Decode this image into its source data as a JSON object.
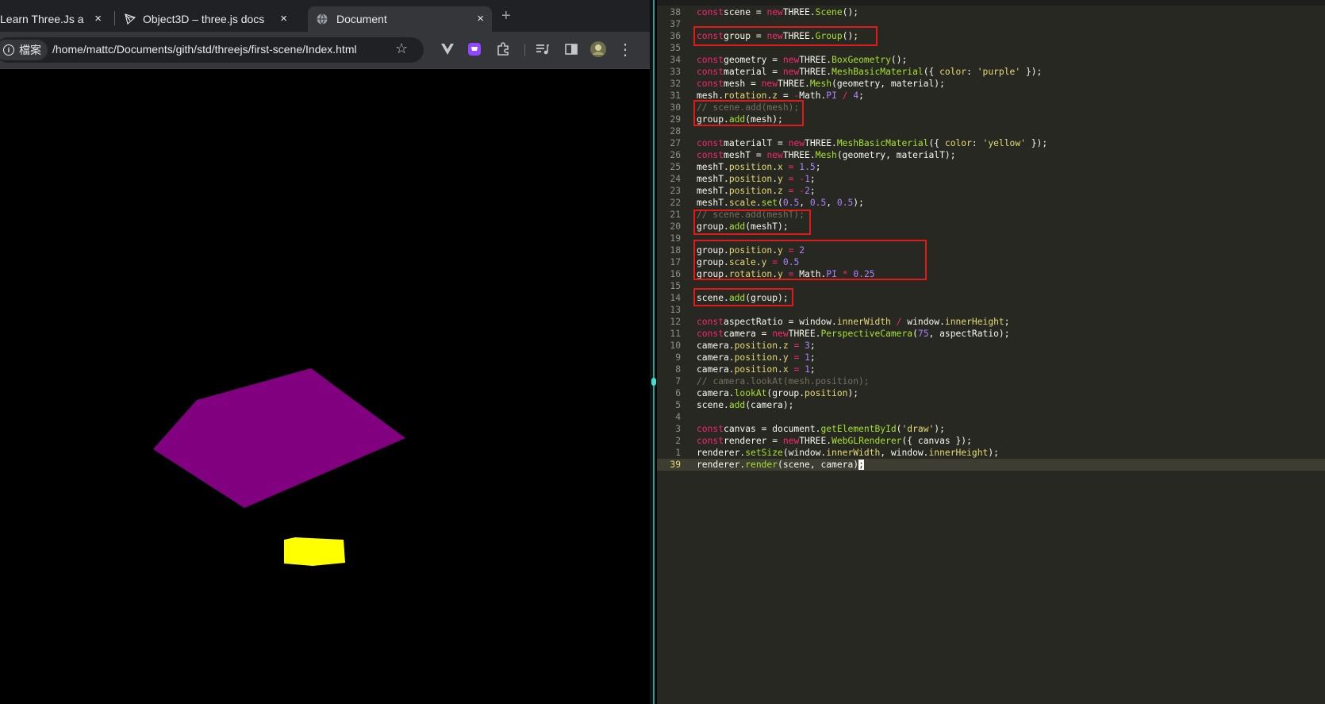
{
  "browser": {
    "tabs": [
      {
        "title": "Learn Three.Js a",
        "close": "×"
      },
      {
        "title": "Object3D – three.js docs",
        "close": "×"
      },
      {
        "title": "Document",
        "close": "×"
      }
    ],
    "new_tab": "+",
    "site_chip": "檔案",
    "url": "/home/mattc/Documents/gith/std/threejs/first-scene/Index.html",
    "scene_colors": {
      "mesh": "#800080",
      "meshT": "#ffff00",
      "background": "#000000"
    }
  },
  "editor": {
    "current_line": "39",
    "lines": [
      {
        "n": "38",
        "t": [
          [
            "k",
            "const"
          ],
          [
            "",
            "scene = "
          ],
          [
            "k",
            "new"
          ],
          [
            "",
            "THREE."
          ],
          [
            "f",
            "Scene"
          ],
          [
            "",
            "();"
          ]
        ]
      },
      {
        "n": "37",
        "t": []
      },
      {
        "n": "36",
        "t": [
          [
            "k",
            "const"
          ],
          [
            "",
            "group = "
          ],
          [
            "k",
            "new"
          ],
          [
            "",
            "THREE."
          ],
          [
            "f",
            "Group"
          ],
          [
            "",
            "();"
          ]
        ]
      },
      {
        "n": "35",
        "t": []
      },
      {
        "n": "34",
        "t": [
          [
            "k",
            "const"
          ],
          [
            "",
            "geometry = "
          ],
          [
            "k",
            "new"
          ],
          [
            "",
            "THREE."
          ],
          [
            "f",
            "BoxGeometry"
          ],
          [
            "",
            "();"
          ]
        ]
      },
      {
        "n": "33",
        "t": [
          [
            "k",
            "const"
          ],
          [
            "",
            "material = "
          ],
          [
            "k",
            "new"
          ],
          [
            "",
            "THREE."
          ],
          [
            "f",
            "MeshBasicMaterial"
          ],
          [
            "",
            "({ "
          ],
          [
            "p",
            "color"
          ],
          [
            "",
            ": "
          ],
          [
            "s",
            "'purple'"
          ],
          [
            "",
            " });"
          ]
        ]
      },
      {
        "n": "32",
        "t": [
          [
            "k",
            "const"
          ],
          [
            "",
            "mesh = "
          ],
          [
            "k",
            "new"
          ],
          [
            "",
            "THREE."
          ],
          [
            "f",
            "Mesh"
          ],
          [
            "",
            "(geometry, material);"
          ]
        ]
      },
      {
        "n": "31",
        "t": [
          [
            "",
            "mesh."
          ],
          [
            "p",
            "rotation"
          ],
          [
            "",
            "."
          ],
          [
            "p",
            "z"
          ],
          [
            "",
            " = "
          ],
          [
            "k",
            "-"
          ],
          [
            "",
            "Math."
          ],
          [
            "n",
            "PI"
          ],
          [
            "",
            " "
          ],
          [
            "k",
            "/"
          ],
          [
            "",
            " "
          ],
          [
            "n",
            "4"
          ],
          [
            "",
            ";"
          ]
        ]
      },
      {
        "n": "30",
        "t": [
          [
            "c",
            "// scene.add(mesh);"
          ]
        ]
      },
      {
        "n": "29",
        "t": [
          [
            "",
            "group."
          ],
          [
            "f",
            "add"
          ],
          [
            "",
            "(mesh);"
          ]
        ]
      },
      {
        "n": "28",
        "t": []
      },
      {
        "n": "27",
        "t": [
          [
            "k",
            "const"
          ],
          [
            "",
            "materialT = "
          ],
          [
            "k",
            "new"
          ],
          [
            "",
            "THREE."
          ],
          [
            "f",
            "MeshBasicMaterial"
          ],
          [
            "",
            "({ "
          ],
          [
            "p",
            "color"
          ],
          [
            "",
            ": "
          ],
          [
            "s",
            "'yellow'"
          ],
          [
            "",
            " });"
          ]
        ]
      },
      {
        "n": "26",
        "t": [
          [
            "k",
            "const"
          ],
          [
            "",
            "meshT = "
          ],
          [
            "k",
            "new"
          ],
          [
            "",
            "THREE."
          ],
          [
            "f",
            "Mesh"
          ],
          [
            "",
            "(geometry, materialT);"
          ]
        ]
      },
      {
        "n": "25",
        "t": [
          [
            "",
            "meshT."
          ],
          [
            "p",
            "position"
          ],
          [
            "",
            "."
          ],
          [
            "p",
            "x"
          ],
          [
            "",
            " "
          ],
          [
            "k",
            "="
          ],
          [
            "",
            " "
          ],
          [
            "n",
            "1.5"
          ],
          [
            "",
            ";"
          ]
        ]
      },
      {
        "n": "24",
        "t": [
          [
            "",
            "meshT."
          ],
          [
            "p",
            "position"
          ],
          [
            "",
            "."
          ],
          [
            "p",
            "y"
          ],
          [
            "",
            " "
          ],
          [
            "k",
            "="
          ],
          [
            "",
            " "
          ],
          [
            "k",
            "-"
          ],
          [
            "n",
            "1"
          ],
          [
            "",
            ";"
          ]
        ]
      },
      {
        "n": "23",
        "t": [
          [
            "",
            "meshT."
          ],
          [
            "p",
            "position"
          ],
          [
            "",
            "."
          ],
          [
            "p",
            "z"
          ],
          [
            "",
            " "
          ],
          [
            "k",
            "="
          ],
          [
            "",
            " "
          ],
          [
            "k",
            "-"
          ],
          [
            "n",
            "2"
          ],
          [
            "",
            ";"
          ]
        ]
      },
      {
        "n": "22",
        "t": [
          [
            "",
            "meshT."
          ],
          [
            "p",
            "scale"
          ],
          [
            "",
            "."
          ],
          [
            "f",
            "set"
          ],
          [
            "",
            "("
          ],
          [
            "n",
            "0.5"
          ],
          [
            "",
            ", "
          ],
          [
            "n",
            "0.5"
          ],
          [
            "",
            ", "
          ],
          [
            "n",
            "0.5"
          ],
          [
            "",
            ");"
          ]
        ]
      },
      {
        "n": "21",
        "t": [
          [
            "c",
            "// scene.add(meshT);"
          ]
        ]
      },
      {
        "n": "20",
        "t": [
          [
            "",
            "group."
          ],
          [
            "f",
            "add"
          ],
          [
            "",
            "(meshT);"
          ]
        ]
      },
      {
        "n": "19",
        "t": []
      },
      {
        "n": "18",
        "t": [
          [
            "",
            "group."
          ],
          [
            "p",
            "position"
          ],
          [
            "",
            "."
          ],
          [
            "p",
            "y"
          ],
          [
            "",
            " "
          ],
          [
            "k",
            "="
          ],
          [
            "",
            " "
          ],
          [
            "n",
            "2"
          ]
        ]
      },
      {
        "n": "17",
        "t": [
          [
            "",
            "group."
          ],
          [
            "p",
            "scale"
          ],
          [
            "",
            "."
          ],
          [
            "p",
            "y"
          ],
          [
            "",
            " "
          ],
          [
            "k",
            "="
          ],
          [
            "",
            " "
          ],
          [
            "n",
            "0.5"
          ]
        ]
      },
      {
        "n": "16",
        "t": [
          [
            "",
            "group."
          ],
          [
            "p",
            "rotation"
          ],
          [
            "",
            "."
          ],
          [
            "p",
            "y"
          ],
          [
            "",
            " "
          ],
          [
            "k",
            "="
          ],
          [
            "",
            " Math."
          ],
          [
            "n",
            "PI"
          ],
          [
            "",
            " "
          ],
          [
            "k",
            "*"
          ],
          [
            "",
            " "
          ],
          [
            "n",
            "0.25"
          ]
        ]
      },
      {
        "n": "15",
        "t": []
      },
      {
        "n": "14",
        "t": [
          [
            "",
            "scene."
          ],
          [
            "f",
            "add"
          ],
          [
            "",
            "(group);"
          ]
        ]
      },
      {
        "n": "13",
        "t": []
      },
      {
        "n": "12",
        "t": [
          [
            "k",
            "const"
          ],
          [
            "",
            "aspectRatio = window."
          ],
          [
            "p",
            "innerWidth"
          ],
          [
            "",
            " "
          ],
          [
            "k",
            "/"
          ],
          [
            "",
            " window."
          ],
          [
            "p",
            "innerHeight"
          ],
          [
            "",
            ";"
          ]
        ]
      },
      {
        "n": "11",
        "t": [
          [
            "k",
            "const"
          ],
          [
            "",
            "camera = "
          ],
          [
            "k",
            "new"
          ],
          [
            "",
            "THREE."
          ],
          [
            "f",
            "PerspectiveCamera"
          ],
          [
            "",
            "("
          ],
          [
            "n",
            "75"
          ],
          [
            "",
            ", aspectRatio);"
          ]
        ]
      },
      {
        "n": "10",
        "t": [
          [
            "",
            "camera."
          ],
          [
            "p",
            "position"
          ],
          [
            "",
            "."
          ],
          [
            "p",
            "z"
          ],
          [
            "",
            " "
          ],
          [
            "k",
            "="
          ],
          [
            "",
            " "
          ],
          [
            "n",
            "3"
          ],
          [
            "",
            ";"
          ]
        ]
      },
      {
        "n": "9",
        "t": [
          [
            "",
            "camera."
          ],
          [
            "p",
            "position"
          ],
          [
            "",
            "."
          ],
          [
            "p",
            "y"
          ],
          [
            "",
            " "
          ],
          [
            "k",
            "="
          ],
          [
            "",
            " "
          ],
          [
            "n",
            "1"
          ],
          [
            "",
            ";"
          ]
        ]
      },
      {
        "n": "8",
        "t": [
          [
            "",
            "camera."
          ],
          [
            "p",
            "position"
          ],
          [
            "",
            "."
          ],
          [
            "p",
            "x"
          ],
          [
            "",
            " "
          ],
          [
            "k",
            "="
          ],
          [
            "",
            " "
          ],
          [
            "n",
            "1"
          ],
          [
            "",
            ";"
          ]
        ]
      },
      {
        "n": "7",
        "t": [
          [
            "c",
            "// camera.lookAt(mesh.position);"
          ]
        ]
      },
      {
        "n": "6",
        "t": [
          [
            "",
            "camera."
          ],
          [
            "f",
            "lookAt"
          ],
          [
            "",
            "(group."
          ],
          [
            "p",
            "position"
          ],
          [
            "",
            ");"
          ]
        ]
      },
      {
        "n": "5",
        "t": [
          [
            "",
            "scene."
          ],
          [
            "f",
            "add"
          ],
          [
            "",
            "(camera);"
          ]
        ]
      },
      {
        "n": "4",
        "t": []
      },
      {
        "n": "3",
        "t": [
          [
            "k",
            "const"
          ],
          [
            "",
            "canvas = document."
          ],
          [
            "f",
            "getElementById"
          ],
          [
            "",
            "("
          ],
          [
            "s",
            "'draw'"
          ],
          [
            "",
            ");"
          ]
        ]
      },
      {
        "n": "2",
        "t": [
          [
            "k",
            "const"
          ],
          [
            "",
            "renderer = "
          ],
          [
            "k",
            "new"
          ],
          [
            "",
            "THREE."
          ],
          [
            "f",
            "WebGLRenderer"
          ],
          [
            "",
            "({ canvas });"
          ]
        ]
      },
      {
        "n": "1",
        "t": [
          [
            "",
            "renderer."
          ],
          [
            "f",
            "setSize"
          ],
          [
            "",
            "(window."
          ],
          [
            "p",
            "innerWidth"
          ],
          [
            "",
            ", window."
          ],
          [
            "p",
            "innerHeight"
          ],
          [
            "",
            ");"
          ]
        ]
      },
      {
        "n": "39",
        "t": [
          [
            "",
            "renderer."
          ],
          [
            "f",
            "render"
          ],
          [
            "",
            "(scene, camera)"
          ],
          [
            "cursor",
            ";"
          ]
        ]
      }
    ],
    "highlight_box_color": "#e01a1a"
  }
}
